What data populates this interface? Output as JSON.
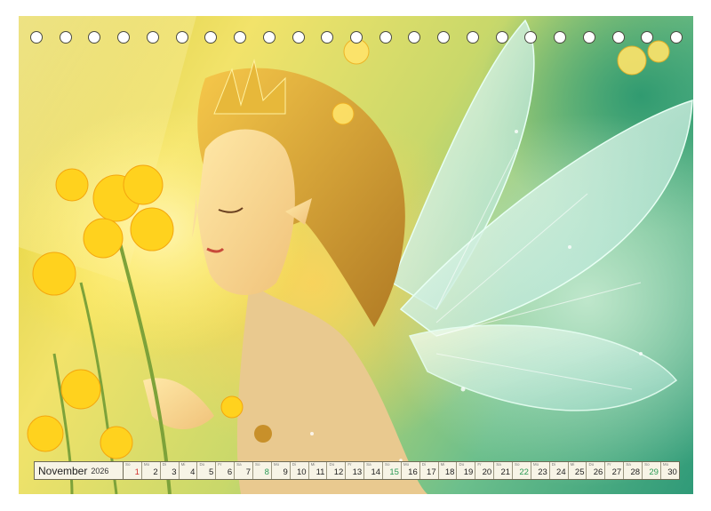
{
  "calendar": {
    "month": "November",
    "year": "2026",
    "days": [
      {
        "num": "1",
        "wd": "So",
        "type": "weekend"
      },
      {
        "num": "2",
        "wd": "Mo",
        "type": ""
      },
      {
        "num": "3",
        "wd": "Di",
        "type": ""
      },
      {
        "num": "4",
        "wd": "Mi",
        "type": ""
      },
      {
        "num": "5",
        "wd": "Do",
        "type": ""
      },
      {
        "num": "6",
        "wd": "Fr",
        "type": ""
      },
      {
        "num": "7",
        "wd": "Sa",
        "type": ""
      },
      {
        "num": "8",
        "wd": "So",
        "type": "holiday"
      },
      {
        "num": "9",
        "wd": "Mo",
        "type": ""
      },
      {
        "num": "10",
        "wd": "Di",
        "type": ""
      },
      {
        "num": "11",
        "wd": "Mi",
        "type": ""
      },
      {
        "num": "12",
        "wd": "Do",
        "type": ""
      },
      {
        "num": "13",
        "wd": "Fr",
        "type": ""
      },
      {
        "num": "14",
        "wd": "Sa",
        "type": ""
      },
      {
        "num": "15",
        "wd": "So",
        "type": "holiday"
      },
      {
        "num": "16",
        "wd": "Mo",
        "type": ""
      },
      {
        "num": "17",
        "wd": "Di",
        "type": ""
      },
      {
        "num": "18",
        "wd": "Mi",
        "type": ""
      },
      {
        "num": "19",
        "wd": "Do",
        "type": ""
      },
      {
        "num": "20",
        "wd": "Fr",
        "type": ""
      },
      {
        "num": "21",
        "wd": "Sa",
        "type": ""
      },
      {
        "num": "22",
        "wd": "So",
        "type": "holiday"
      },
      {
        "num": "23",
        "wd": "Mo",
        "type": ""
      },
      {
        "num": "24",
        "wd": "Di",
        "type": ""
      },
      {
        "num": "25",
        "wd": "Mi",
        "type": ""
      },
      {
        "num": "26",
        "wd": "Do",
        "type": ""
      },
      {
        "num": "27",
        "wd": "Fr",
        "type": ""
      },
      {
        "num": "28",
        "wd": "Sa",
        "type": ""
      },
      {
        "num": "29",
        "wd": "So",
        "type": "holiday"
      },
      {
        "num": "30",
        "wd": "Mo",
        "type": ""
      }
    ]
  },
  "binding": {
    "hole_count": 23
  },
  "colors": {
    "weekend": "#d2322f",
    "holiday": "#2a9a56",
    "bar_background": "#f7f4e6"
  }
}
